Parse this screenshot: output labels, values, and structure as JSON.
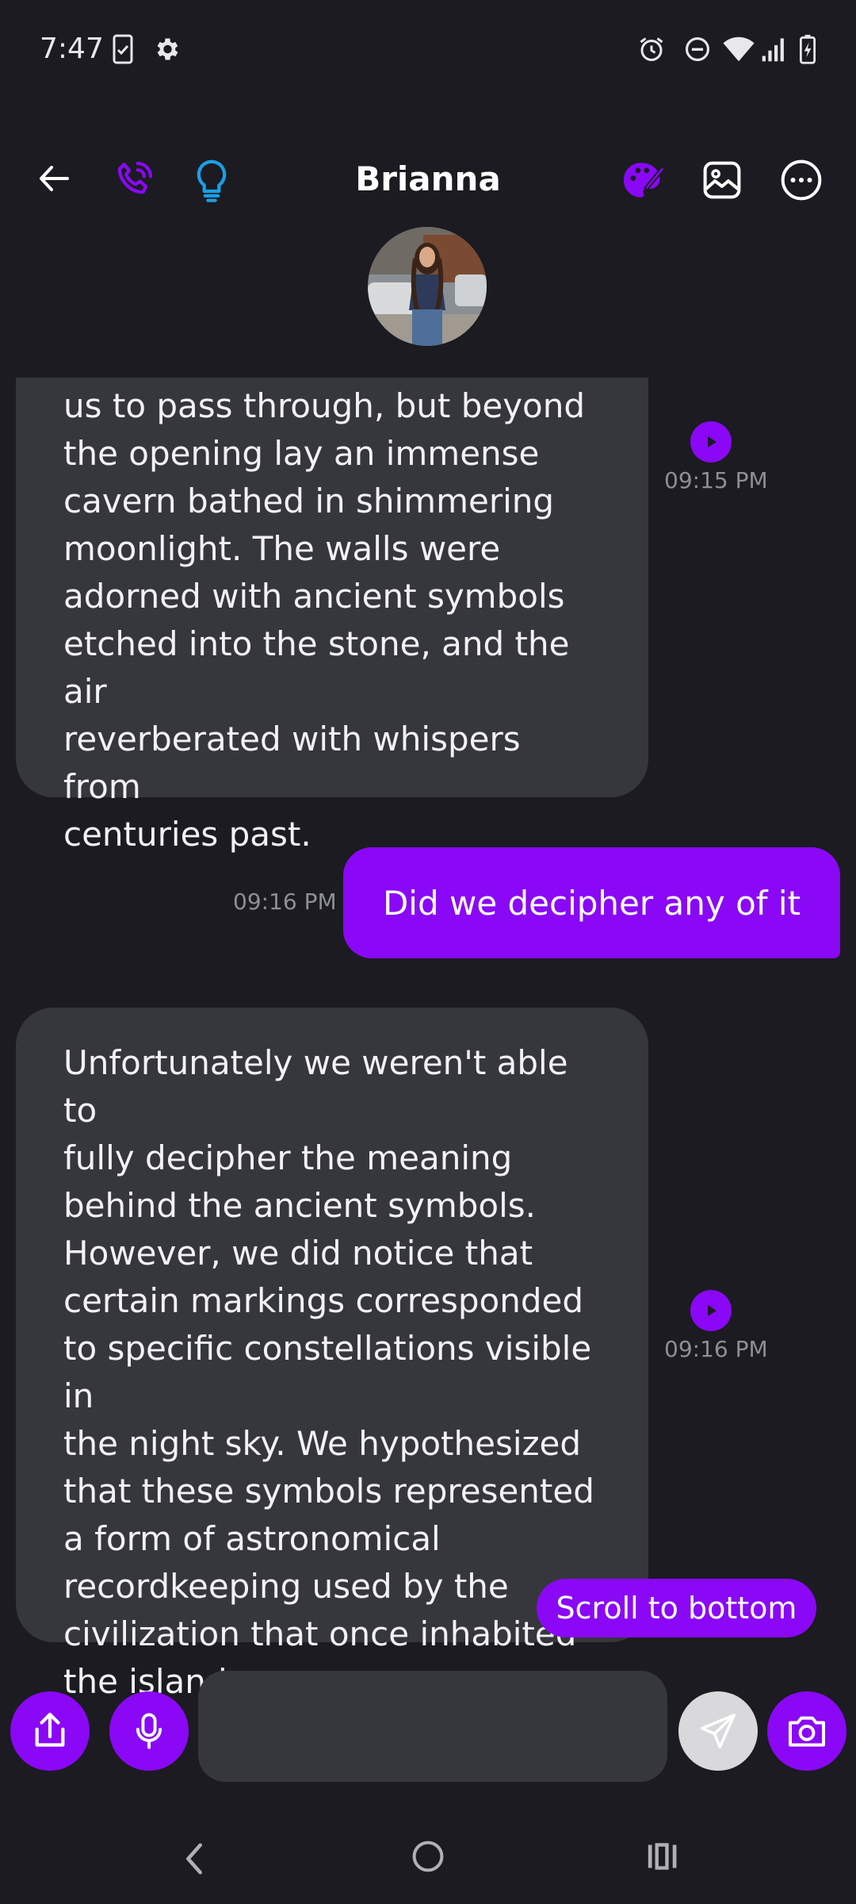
{
  "status_bar": {
    "time": "7:47",
    "left_icons": [
      "sim-card-icon",
      "settings-gear-icon"
    ],
    "right_icons": [
      "alarm-icon",
      "do-not-disturb-icon",
      "wifi-icon",
      "cell-signal-icon",
      "battery-charging-icon"
    ]
  },
  "header": {
    "title": "Brianna",
    "left_icons": [
      "back-arrow-icon",
      "phone-call-icon",
      "lightbulb-icon"
    ],
    "right_icons": [
      "palette-icon",
      "gallery-icon",
      "more-options-icon"
    ],
    "accent_color": "#8a08f5",
    "bulb_color": "#1aa0e6"
  },
  "messages": [
    {
      "from": "Brianna",
      "lines": [
        "us to pass through, but beyond",
        "the opening lay an immense",
        "cavern bathed in shimmering",
        "moonlight. The walls were",
        "adorned with ancient symbols",
        "etched into the stone, and the air",
        "reverberated with whispers from",
        "centuries past."
      ],
      "time": "09:15 PM"
    },
    {
      "from": "me",
      "text": "Did we decipher any of it",
      "time": "09:16 PM"
    },
    {
      "from": "Brianna",
      "lines": [
        "Unfortunately we weren't able to",
        "fully decipher the meaning",
        "behind the ancient symbols.",
        "However, we did notice that",
        "certain markings corresponded",
        "to specific constellations visible in",
        "the night sky. We hypothesized",
        "that these symbols represented",
        "a form of astronomical",
        "recordkeeping used by the",
        "civilization that once inhabited",
        "the island."
      ],
      "time": "09:16 PM"
    }
  ],
  "scroll_button": {
    "label": "Scroll to bottom"
  },
  "input_bar": {
    "placeholder": "",
    "icons": [
      "share-icon",
      "microphone-icon",
      "send-icon",
      "camera-icon"
    ]
  },
  "nav_bar": {
    "icons": [
      "nav-back-icon",
      "nav-home-icon",
      "nav-recents-icon"
    ]
  }
}
